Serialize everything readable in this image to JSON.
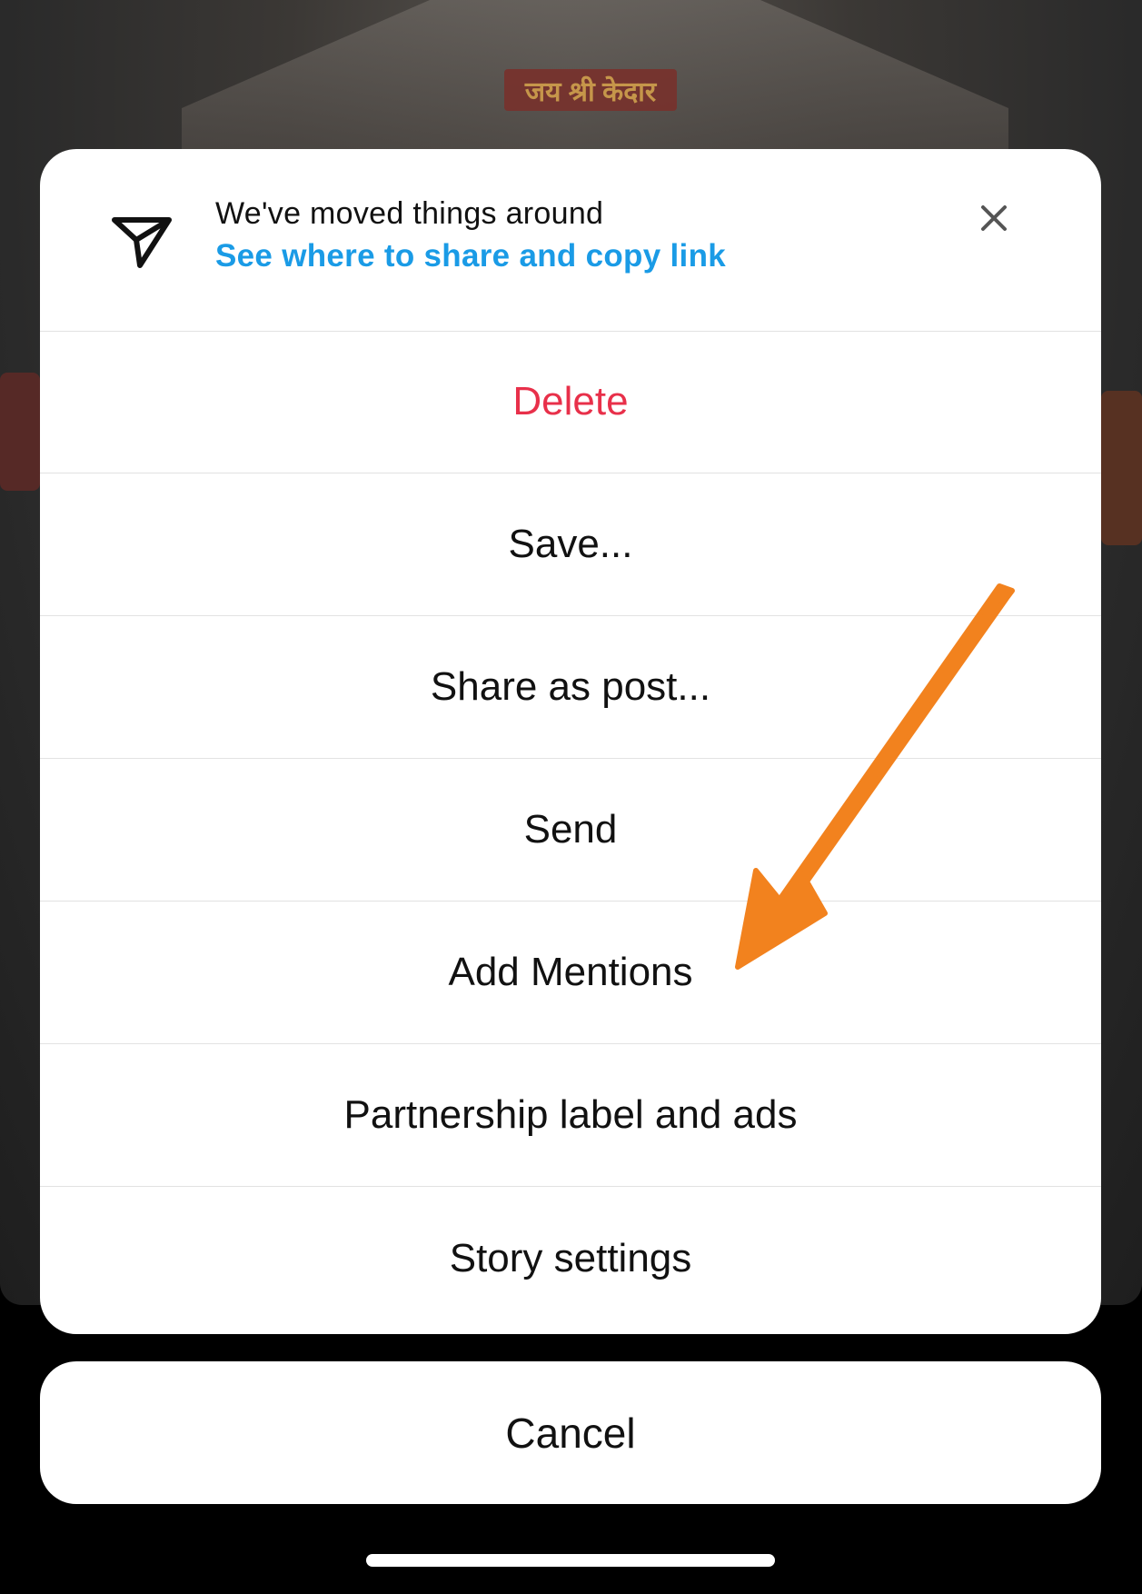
{
  "background": {
    "sign_text": "जय श्री केदार"
  },
  "notice": {
    "icon": "send-icon",
    "title": "We've moved things around",
    "link": "See where to share and copy link",
    "close_icon": "close-icon"
  },
  "menu": {
    "items": [
      {
        "label": "Delete",
        "style": "destructive"
      },
      {
        "label": "Save..."
      },
      {
        "label": "Share as post..."
      },
      {
        "label": "Send"
      },
      {
        "label": "Add Mentions"
      },
      {
        "label": "Partnership label and ads"
      },
      {
        "label": "Story settings"
      }
    ]
  },
  "cancel_label": "Cancel",
  "colors": {
    "link": "#1a9be6",
    "destructive": "#e8304a",
    "annotation_arrow": "#f2821e"
  }
}
